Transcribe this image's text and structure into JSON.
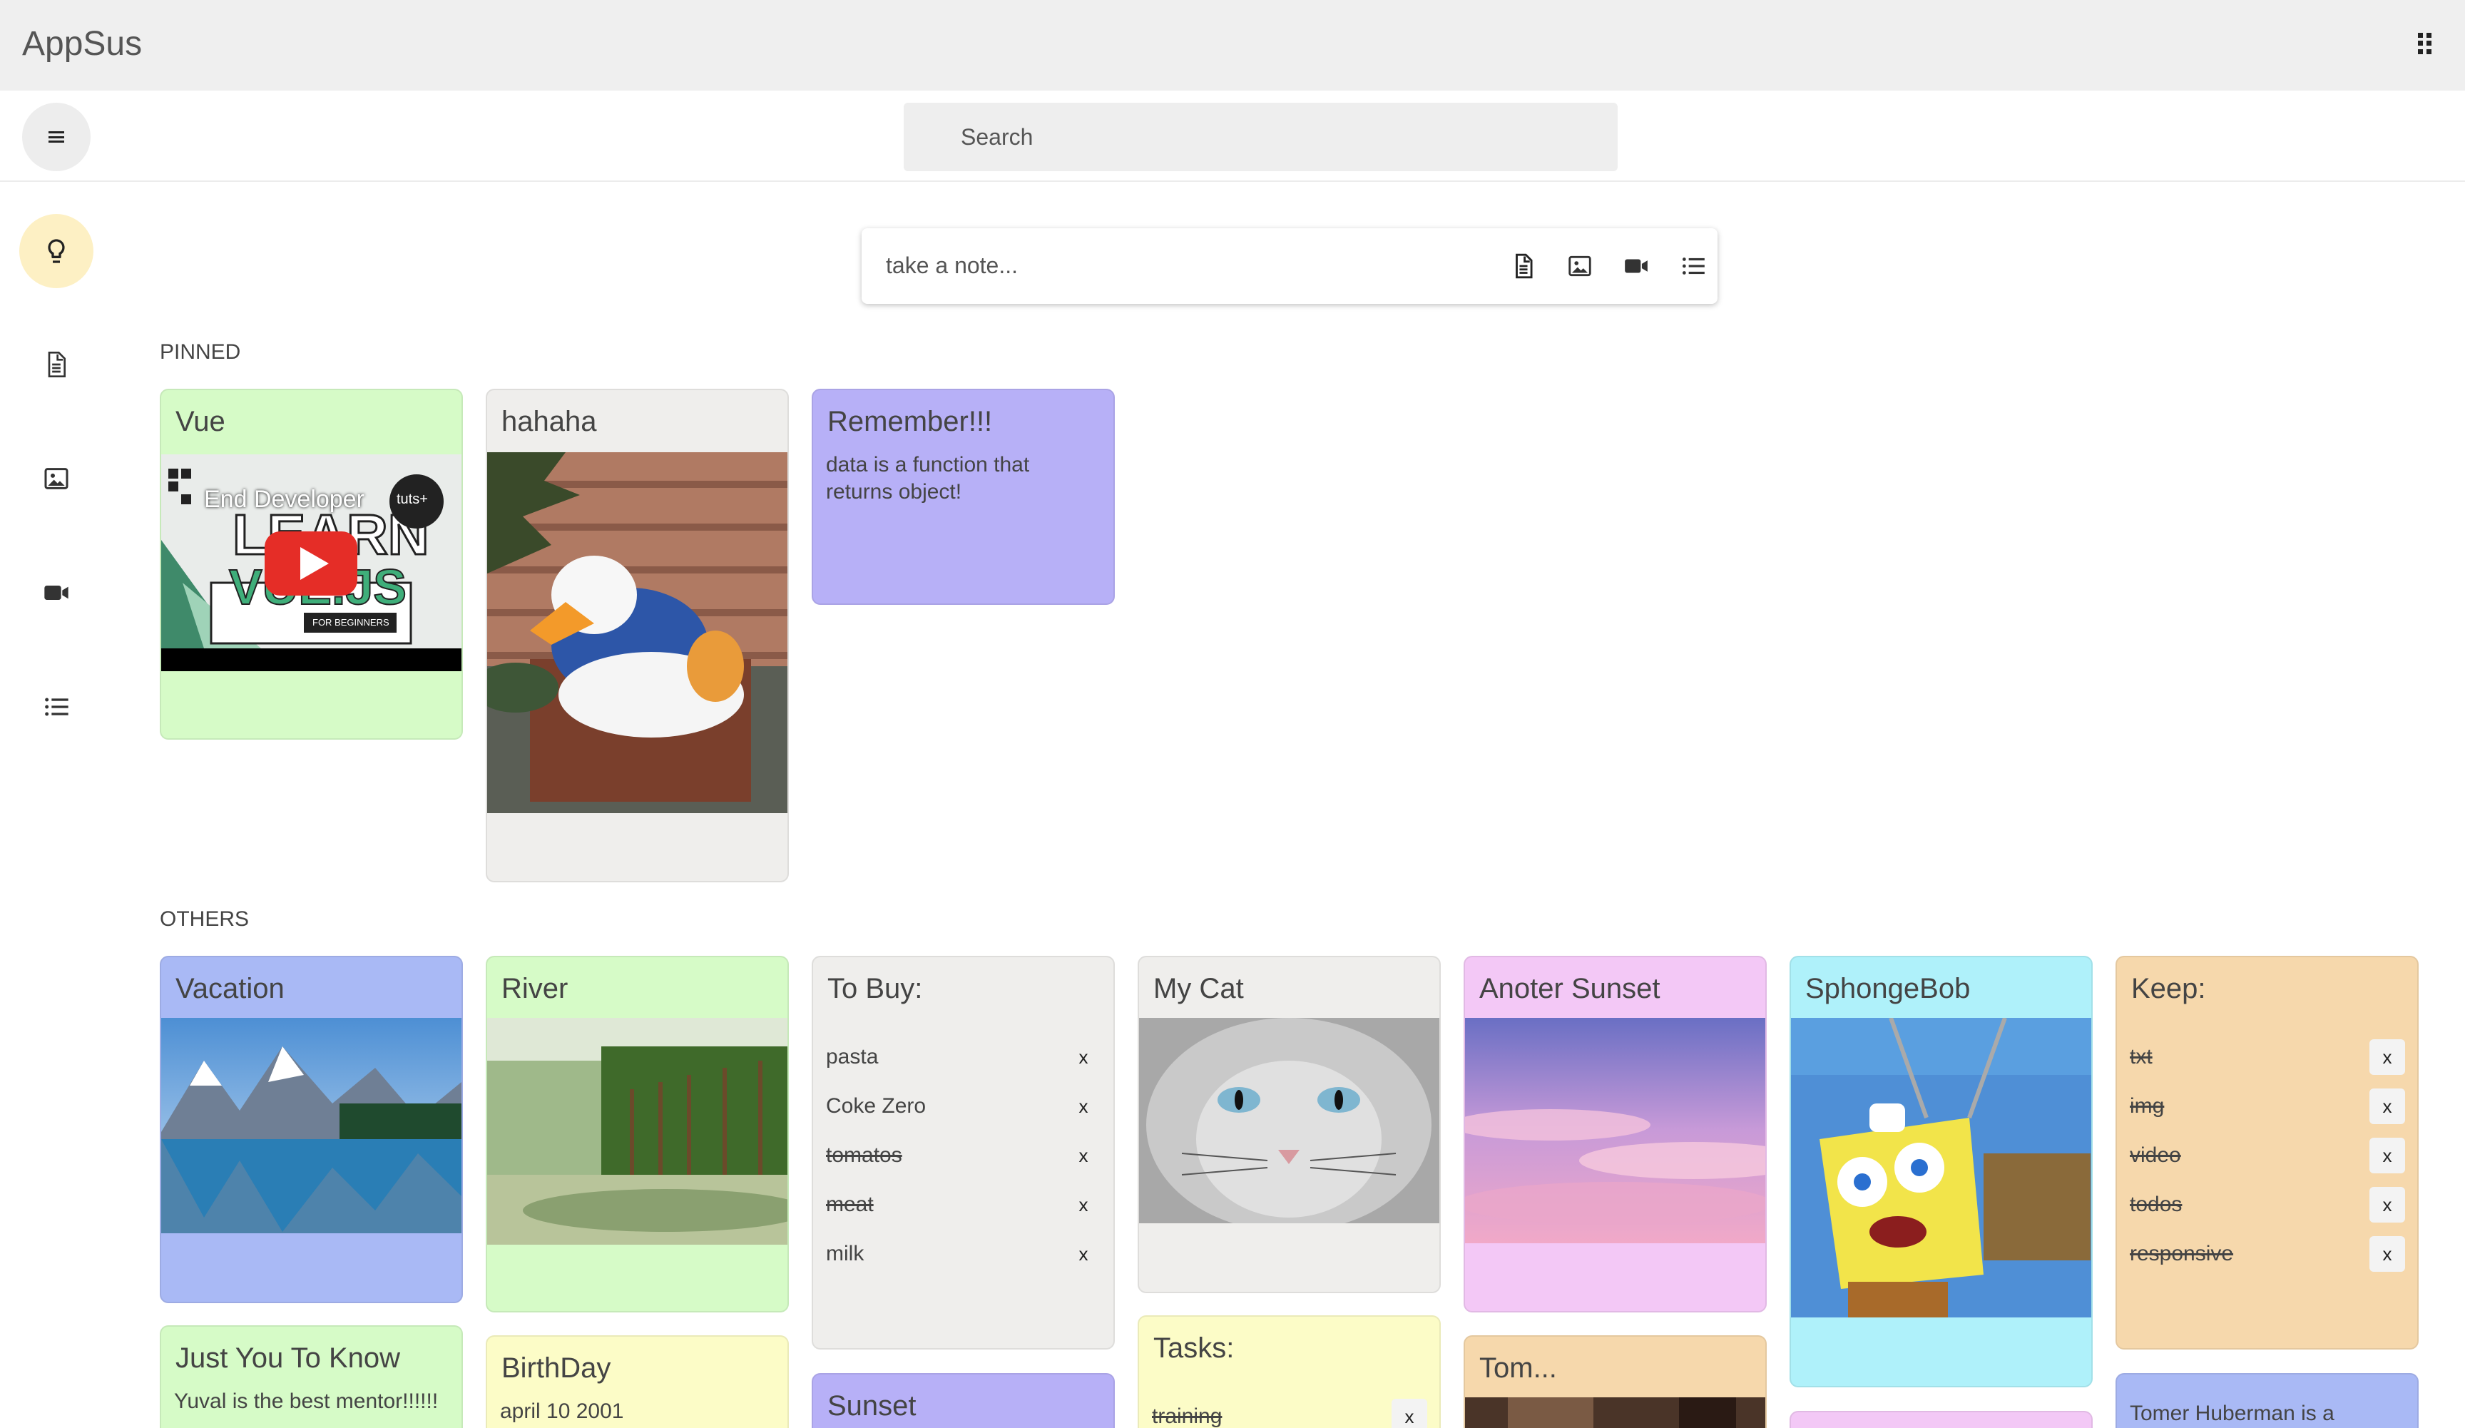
{
  "app": {
    "title": "AppSus"
  },
  "header": {
    "search_placeholder": "Search"
  },
  "composer": {
    "placeholder": "take a note..."
  },
  "sections": {
    "pinned": "PINNED",
    "others": "OTHERS"
  },
  "colors": {
    "green": "#d6fbc7",
    "gray": "#efeeec",
    "purple": "#b7b0f7",
    "blue": "#a9b9f5",
    "pink": "#f3c8f6",
    "cyan": "#aff1fa",
    "orange": "#f6d8ac",
    "yellow": "#fcfcc7",
    "nav_active": "#fdf0c4"
  },
  "notes": {
    "vue": {
      "title": "Vue",
      "video_caption": "End Developer",
      "video_badge": "tuts+",
      "video_sub": "FOR BEGINNERS"
    },
    "hahaha": {
      "title": "hahaha"
    },
    "remember": {
      "title": "Remember!!!",
      "text": "data is a function that returns object!"
    },
    "vacation": {
      "title": "Vacation"
    },
    "river": {
      "title": "River"
    },
    "tobuy": {
      "title": "To Buy:",
      "items": [
        {
          "label": "pasta",
          "done": false
        },
        {
          "label": "Coke Zero",
          "done": false
        },
        {
          "label": "tomatos",
          "done": true
        },
        {
          "label": "meat",
          "done": true
        },
        {
          "label": "milk",
          "done": false
        }
      ]
    },
    "mycat": {
      "title": "My Cat"
    },
    "anoter_sunset": {
      "title": "Anoter Sunset"
    },
    "sphongebob": {
      "title": "SphongeBob"
    },
    "keep": {
      "title": "Keep:",
      "items": [
        {
          "label": "txt",
          "done": true
        },
        {
          "label": "img",
          "done": true
        },
        {
          "label": "video",
          "done": true
        },
        {
          "label": "todos",
          "done": true
        },
        {
          "label": "responsive",
          "done": true
        }
      ]
    },
    "just_you": {
      "title": "Just You To Know",
      "text": "Yuval is the best mentor!!!!!!"
    },
    "birthday": {
      "title": "BirthDay",
      "text": "april 10 2001"
    },
    "sunset": {
      "title": "Sunset"
    },
    "tasks": {
      "title": "Tasks:",
      "items": [
        {
          "label": "training",
          "done": true
        }
      ]
    },
    "tom": {
      "title": "Tom..."
    },
    "tomer": {
      "text": "Tomer Huberman is a"
    }
  },
  "remove_label": "x"
}
